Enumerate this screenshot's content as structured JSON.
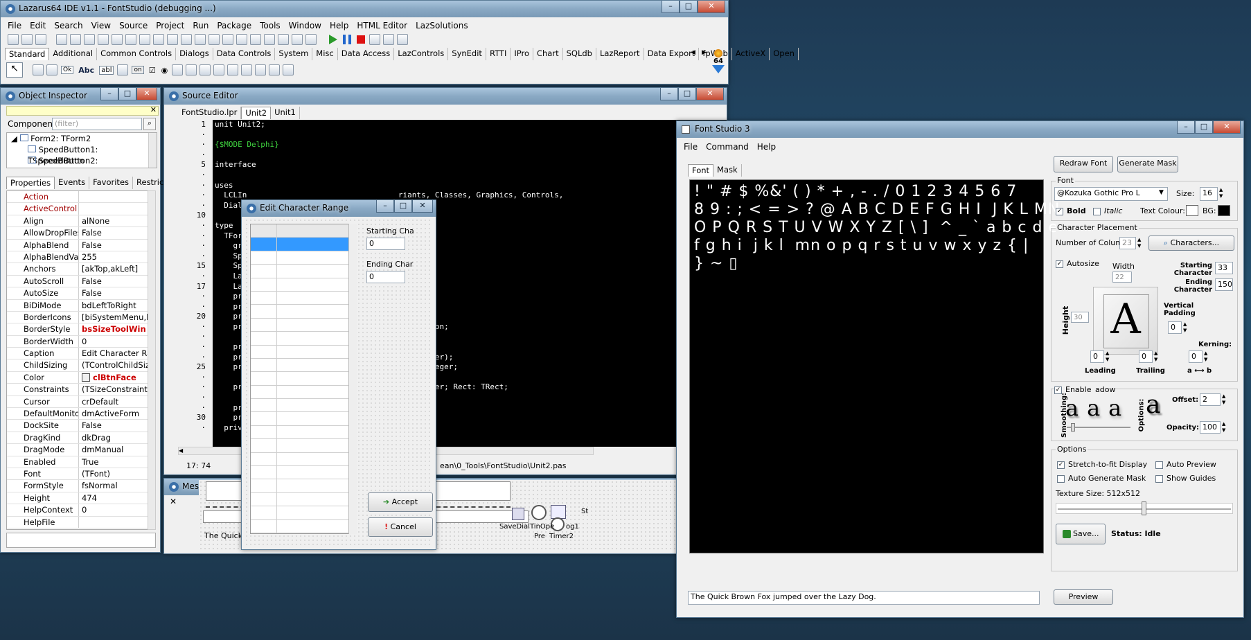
{
  "ide": {
    "title": "Lazarus64 IDE v1.1 - FontStudio (debugging ...)",
    "menu": [
      "File",
      "Edit",
      "Search",
      "View",
      "Source",
      "Project",
      "Run",
      "Package",
      "Tools",
      "Window",
      "Help",
      "HTML Editor",
      "LazSolutions"
    ],
    "palette_tabs": [
      "Standard",
      "Additional",
      "Common Controls",
      "Dialogs",
      "Data Controls",
      "System",
      "Misc",
      "Data Access",
      "LazControls",
      "SynEdit",
      "RTTI",
      "IPro",
      "Chart",
      "SQLdb",
      "LazReport",
      "Data Export",
      "fpWeb",
      "ActiveX",
      "Open"
    ],
    "badge": "64"
  },
  "object_inspector": {
    "title": "Object Inspector",
    "components_label": "Components",
    "filter_placeholder": "(filter)",
    "tree": [
      "Form2: TForm2",
      "SpeedButton1: TSpeedButton",
      "SpeedButton2: TSpeedButton"
    ],
    "tabs": [
      "Properties",
      "Events",
      "Favorites",
      "Restricted"
    ],
    "properties": [
      {
        "name": "Action",
        "value": "",
        "red": true
      },
      {
        "name": "ActiveControl",
        "value": "",
        "red": true
      },
      {
        "name": "Align",
        "value": "alNone"
      },
      {
        "name": "AllowDropFiles",
        "value": "False"
      },
      {
        "name": "AlphaBlend",
        "value": "False"
      },
      {
        "name": "AlphaBlendValue",
        "value": "255"
      },
      {
        "name": "Anchors",
        "value": "[akTop,akLeft]",
        "expand": true
      },
      {
        "name": "AutoScroll",
        "value": "False"
      },
      {
        "name": "AutoSize",
        "value": "False"
      },
      {
        "name": "BiDiMode",
        "value": "bdLeftToRight"
      },
      {
        "name": "BorderIcons",
        "value": "[biSystemMenu,biM",
        "expand": true
      },
      {
        "name": "BorderStyle",
        "value": "bsSizeToolWin",
        "bold": true
      },
      {
        "name": "BorderWidth",
        "value": "0"
      },
      {
        "name": "Caption",
        "value": "Edit Character Range"
      },
      {
        "name": "ChildSizing",
        "value": "(TControlChildSizing",
        "expand": true
      },
      {
        "name": "Color",
        "value": "clBtnFace",
        "bold": true
      },
      {
        "name": "Constraints",
        "value": "(TSizeConstraints)",
        "expand": true
      },
      {
        "name": "Cursor",
        "value": "crDefault"
      },
      {
        "name": "DefaultMonitor",
        "value": "dmActiveForm"
      },
      {
        "name": "DockSite",
        "value": "False"
      },
      {
        "name": "DragKind",
        "value": "dkDrag"
      },
      {
        "name": "DragMode",
        "value": "dmManual"
      },
      {
        "name": "Enabled",
        "value": "True"
      },
      {
        "name": "Font",
        "value": "(TFont)",
        "expand": true
      },
      {
        "name": "FormStyle",
        "value": "fsNormal"
      },
      {
        "name": "Height",
        "value": "474"
      },
      {
        "name": "HelpContext",
        "value": "0"
      },
      {
        "name": "HelpFile",
        "value": ""
      }
    ]
  },
  "source_editor": {
    "title": "Source Editor",
    "tabs": [
      "FontStudio.lpr",
      "Unit2",
      "Unit1"
    ],
    "gutter": [
      "1",
      "·",
      "·",
      "·",
      "5",
      "·",
      "·",
      "·",
      "·",
      "10",
      "·",
      "·",
      "·",
      "·",
      "15",
      "·",
      "17",
      "·",
      "·",
      "20",
      "·",
      "·",
      "·",
      "·",
      "25",
      "·",
      "·",
      "·",
      "·",
      "30",
      "·"
    ],
    "lines": [
      {
        "t": "unit Unit2;",
        "c": "#fff"
      },
      {
        "t": "",
        "c": "#fff"
      },
      {
        "t": "{$MODE Delphi}",
        "c": "#3fd23f"
      },
      {
        "t": "",
        "c": "#fff"
      },
      {
        "t": "interface",
        "c": "#fff"
      },
      {
        "t": "",
        "c": "#fff"
      },
      {
        "t": "uses",
        "c": "#fff"
      },
      {
        "t": "  LCLIn                                 riants, Classes, Graphics, Controls,",
        "c": "#fff"
      },
      {
        "t": "  Dialo",
        "c": "#fff"
      },
      {
        "t": "",
        "c": "#fff"
      },
      {
        "t": "type",
        "c": "#fff"
      },
      {
        "t": "  TForm",
        "c": "#fff"
      },
      {
        "t": "    gr",
        "c": "#fff"
      },
      {
        "t": "    Spe",
        "c": "#fff"
      },
      {
        "t": "    Spe",
        "c": "#fff"
      },
      {
        "t": "    Lab",
        "c": "#fff"
      },
      {
        "t": "    Lab",
        "c": "#fff"
      },
      {
        "t": "    pro",
        "c": "#fff"
      },
      {
        "t": "    pro",
        "c": "#fff"
      },
      {
        "t": "    pro",
        "c": "#fff"
      },
      {
        "t": "    pro                                 ouseButton;",
        "c": "#fff"
      },
      {
        "t": "      S",
        "c": "#fff"
      },
      {
        "t": "    pro",
        "c": "#fff"
      },
      {
        "t": "    pro                                 Y: Integer);",
        "c": "#fff"
      },
      {
        "t": "    pro                                 Row: Integer;",
        "c": "#fff"
      },
      {
        "t": "      v",
        "c": "#fff"
      },
      {
        "t": "    pro                                 w: Integer; Rect: TRect;",
        "c": "#fff"
      },
      {
        "t": "      S",
        "c": "#fff"
      },
      {
        "t": "    pro",
        "c": "#fff"
      },
      {
        "t": "    pro",
        "c": "#fff"
      },
      {
        "t": "  priva",
        "c": "#fff"
      }
    ],
    "status_pos": "17: 74",
    "status_path": "ean\\0_Tools\\FontStudio\\Unit2.pas"
  },
  "messages": {
    "title": "Mes",
    "sample": "The Quick Brown Fox jumped over the Lazy Dog.",
    "comp_labels": [
      "SaveDial",
      "TinOpe",
      "og1",
      "Pre",
      "Timer2",
      "St"
    ]
  },
  "edit_range": {
    "title": "Edit Character Range",
    "starting_label": "Starting Cha",
    "starting_value": "0",
    "ending_label": "Ending Char",
    "ending_value": "0",
    "accept": "Accept",
    "cancel": "Cancel"
  },
  "font_studio": {
    "title": "Font Studio 3",
    "menu": [
      "File",
      "Command",
      "Help"
    ],
    "tabs": [
      "Font",
      "Mask"
    ],
    "glyph_rows": [
      "! \" # $ %&' ( ) * + , - . / 0 1 2 3 4 5 6 7",
      "8 9 : ; < = > ? @ A B C D E F G H I  J K L MN",
      "O P Q R S T U V W X Y Z [ \\ ]  ^ _ ` a b c d e",
      "f g h i  j k l  mn o p q r s t u v w x y z { |",
      "} ~ ▯"
    ],
    "preview_text": "The Quick Brown Fox jumped over the Lazy Dog.",
    "preview_btn": "Preview",
    "redraw_btn": "Redraw Font",
    "genmask_btn": "Generate Mask",
    "font_group": "Font",
    "font_name": "@Kozuka Gothic Pro L",
    "size_label": "Size:",
    "size_value": "16",
    "bold_label": "Bold",
    "italic_label": "Italic",
    "text_colour_label": "Text Colour:",
    "bg_label": "BG:",
    "placement_group": "Character Placement",
    "columns_label": "Number of Columns:",
    "columns_value": "23",
    "characters_btn": "Characters...",
    "autosize_label": "Autosize",
    "width_label": "Width",
    "width_value": "22",
    "height_label": "Height",
    "height_value": "30",
    "starting_char_label": "Starting Character",
    "starting_char_value": "33",
    "ending_char_label": "Ending Character",
    "ending_char_value": "150",
    "vpad_label": "Vertical Padding",
    "vpad_value": "0",
    "kerning_label": "Kerning:",
    "kerning_value": "0",
    "leading_label": "Leading",
    "leading_value": "0",
    "trailing_label": "Trailing",
    "trailing_value": "0",
    "ab_label": "a ⟷ b",
    "preview_glyph": "A",
    "shadow_enable": "Enable",
    "shadow_title": "adow",
    "smoothing_label": "Smoothing:",
    "options_vert_label": "Options:",
    "offset_label": "Offset:",
    "offset_value": "2",
    "opacity_label": "Opacity:",
    "opacity_value": "100",
    "shadow_glyph": "a",
    "options_group": "Options",
    "stretch_label": "Stretch-to-fit Display",
    "auto_preview_label": "Auto Preview",
    "auto_mask_label": "Auto Generate Mask",
    "show_guides_label": "Show Guides",
    "texture_label": "Texture Size: 512x512",
    "texture_level": 0.5,
    "save_btn": "Save...",
    "status": "Status: Idle"
  },
  "colors": {
    "accent_select": "#3399ff",
    "red_prop": "#a00000",
    "dark_red": "#cc0000"
  }
}
